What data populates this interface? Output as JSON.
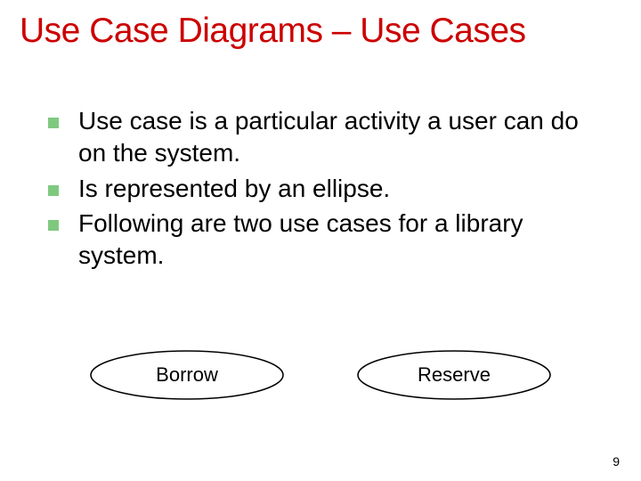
{
  "title": "Use Case Diagrams – Use Cases",
  "bullets": [
    "Use case is a particular activity a user can do on the system.",
    "Is represented by an ellipse.",
    "Following are two use cases for a library system."
  ],
  "use_cases": {
    "left": "Borrow",
    "right": "Reserve"
  },
  "page_number": "9",
  "colors": {
    "title": "#cc0000",
    "bullet_square": "#7fc97f"
  }
}
